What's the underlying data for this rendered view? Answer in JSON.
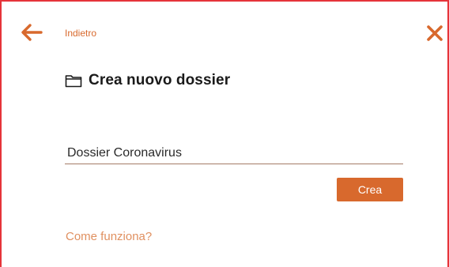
{
  "header": {
    "back_icon": "arrow-left-icon",
    "back_label": "Indietro",
    "close_icon": "close-icon"
  },
  "dialog": {
    "title_icon": "folder-icon",
    "title": "Crea nuovo dossier",
    "name_input": {
      "value": "Dossier Coronavirus"
    },
    "create_label": "Crea",
    "help_link": "Come funziona?"
  },
  "colors": {
    "accent": "#d8692d",
    "link": "#e09060",
    "frame_border": "#e5343a",
    "title_text": "#1a1a1a"
  }
}
